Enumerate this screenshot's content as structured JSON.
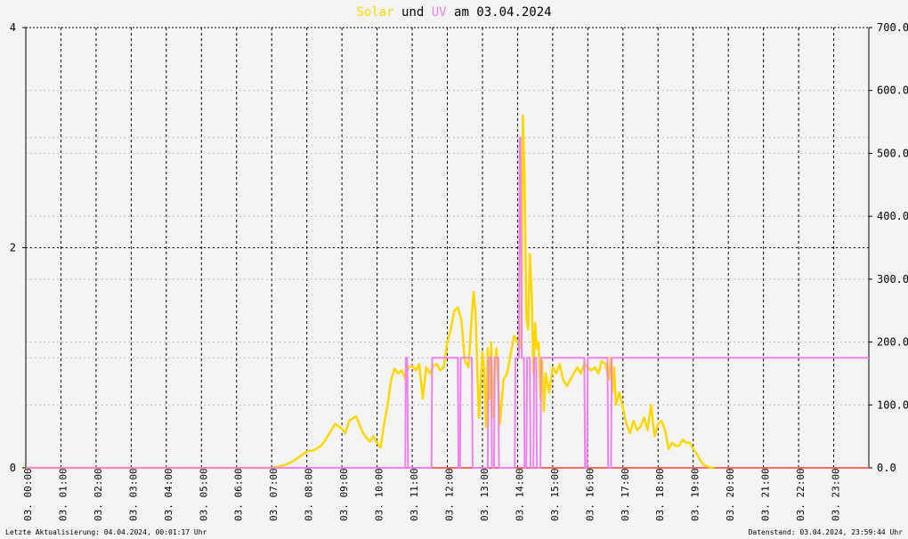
{
  "title": {
    "solar_word": "Solar",
    "und_word": "und",
    "uv_word": "UV",
    "rest": "am 03.04.2024"
  },
  "colors": {
    "solar": "#ffd700",
    "uv": "#ee82ee",
    "background": "#f4f4f4",
    "zero_line": "#ff6666"
  },
  "footer": {
    "left": "Letzte Aktualisierung: 04.04.2024, 00:01:17 Uhr",
    "right": "Datenstand: 03.04.2024, 23:59:44 Uhr"
  },
  "chart_data": {
    "type": "line",
    "grid": true,
    "x_tick_labels": [
      "03. 00:00",
      "03. 01:00",
      "03. 02:00",
      "03. 03:00",
      "03. 04:00",
      "03. 05:00",
      "03. 06:00",
      "03. 07:00",
      "03. 08:00",
      "03. 09:00",
      "03. 10:00",
      "03. 11:00",
      "03. 12:00",
      "03. 13:00",
      "03. 14:00",
      "03. 15:00",
      "03. 16:00",
      "03. 17:00",
      "03. 18:00",
      "03. 19:00",
      "03. 20:00",
      "03. 21:00",
      "03. 22:00",
      "03. 23:00"
    ],
    "x_range_hours": [
      0,
      24
    ],
    "left_axis": {
      "ylim": [
        0,
        4
      ],
      "tick_labels": [
        "0",
        "2",
        "4"
      ]
    },
    "right_axis": {
      "ylim": [
        0,
        700
      ],
      "tick_labels": [
        "0.0",
        "100.0",
        "200.0",
        "300.0",
        "400.0",
        "500.0",
        "600.0",
        "700.0"
      ]
    },
    "series": [
      {
        "name": "Solar",
        "axis": "right",
        "x_hours": [
          0,
          7.0,
          7.2,
          7.4,
          7.6,
          7.8,
          8.0,
          8.2,
          8.4,
          8.5,
          8.7,
          8.8,
          9.0,
          9.1,
          9.2,
          9.3,
          9.4,
          9.6,
          9.7,
          9.8,
          9.9,
          10.0,
          10.1,
          10.2,
          10.3,
          10.4,
          10.5,
          10.6,
          10.7,
          10.8,
          10.9,
          11.0,
          11.1,
          11.2,
          11.3,
          11.4,
          11.5,
          11.6,
          11.7,
          11.8,
          11.9,
          12.0,
          12.1,
          12.2,
          12.3,
          12.4,
          12.5,
          12.6,
          12.7,
          12.75,
          12.8,
          12.9,
          13.0,
          13.05,
          13.1,
          13.15,
          13.2,
          13.25,
          13.3,
          13.35,
          13.4,
          13.5,
          13.6,
          13.7,
          13.8,
          13.9,
          14.0,
          14.1,
          14.15,
          14.2,
          14.25,
          14.3,
          14.35,
          14.4,
          14.45,
          14.5,
          14.55,
          14.6,
          14.65,
          14.7,
          14.75,
          14.8,
          14.9,
          15.0,
          15.1,
          15.2,
          15.3,
          15.4,
          15.5,
          15.6,
          15.7,
          15.8,
          15.9,
          16.0,
          16.1,
          16.2,
          16.3,
          16.4,
          16.5,
          16.6,
          16.65,
          16.7,
          16.75,
          16.8,
          16.9,
          17.0,
          17.1,
          17.2,
          17.3,
          17.4,
          17.5,
          17.6,
          17.7,
          17.8,
          17.9,
          18.0,
          18.1,
          18.2,
          18.3,
          18.4,
          18.5,
          18.6,
          18.7,
          18.8,
          18.9,
          19.0,
          19.1,
          19.2,
          19.3,
          19.4,
          19.5,
          19.6,
          19.7,
          19.8,
          19.9,
          20.0,
          20.1,
          24
        ],
        "values": [
          0,
          0,
          2,
          5,
          10,
          18,
          26,
          28,
          35,
          42,
          60,
          70,
          62,
          55,
          75,
          78,
          82,
          55,
          48,
          42,
          50,
          40,
          32,
          70,
          100,
          140,
          158,
          150,
          155,
          142,
          160,
          162,
          155,
          165,
          110,
          160,
          150,
          162,
          165,
          155,
          160,
          200,
          220,
          250,
          255,
          235,
          170,
          160,
          245,
          280,
          250,
          80,
          185,
          155,
          65,
          190,
          110,
          200,
          80,
          160,
          190,
          70,
          140,
          150,
          180,
          210,
          200,
          190,
          560,
          460,
          240,
          220,
          340,
          280,
          150,
          230,
          190,
          200,
          110,
          170,
          90,
          150,
          120,
          160,
          150,
          165,
          140,
          130,
          140,
          150,
          160,
          150,
          165,
          160,
          155,
          160,
          150,
          170,
          165,
          140,
          175,
          120,
          160,
          100,
          120,
          95,
          70,
          55,
          75,
          60,
          65,
          80,
          60,
          100,
          50,
          70,
          75,
          60,
          30,
          40,
          35,
          35,
          45,
          40,
          40,
          30,
          22,
          12,
          5,
          2,
          0,
          0
        ]
      },
      {
        "name": "UV",
        "axis": "left",
        "x_hours": [
          0,
          10.8,
          10.82,
          10.86,
          10.88,
          11.55,
          11.57,
          12.3,
          12.32,
          12.36,
          12.38,
          12.7,
          12.72,
          13.15,
          13.17,
          13.25,
          13.27,
          13.33,
          13.35,
          13.45,
          13.47,
          13.92,
          13.94,
          14.04,
          14.06,
          14.08,
          14.12,
          14.18,
          14.2,
          14.25,
          14.27,
          14.35,
          14.37,
          14.45,
          14.47,
          14.53,
          14.55,
          14.65,
          14.67,
          15.9,
          15.92,
          15.98,
          16.0,
          16.56,
          16.58,
          16.66,
          16.68,
          24
        ],
        "values": [
          0,
          0,
          1,
          1,
          0,
          0,
          1,
          1,
          0,
          0,
          1,
          1,
          0,
          0,
          1,
          1,
          0,
          0,
          1,
          1,
          0,
          0,
          1,
          1,
          3,
          3,
          1,
          1,
          0,
          0,
          1,
          1,
          0,
          0,
          1,
          1,
          0,
          0,
          1,
          1,
          0,
          0,
          1,
          1,
          0,
          0,
          1,
          1,
          0,
          0,
          0
        ]
      }
    ]
  }
}
